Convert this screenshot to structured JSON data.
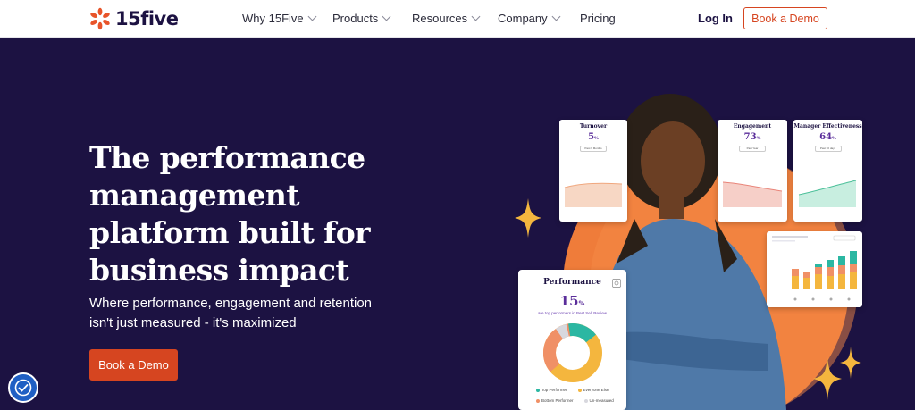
{
  "brand": {
    "name": "15five",
    "accent": "#d64520",
    "navy": "#1c1242"
  },
  "nav": {
    "items": [
      {
        "label": "Why 15Five",
        "dropdown": true
      },
      {
        "label": "Products",
        "dropdown": true
      },
      {
        "label": "Resources",
        "dropdown": true
      },
      {
        "label": "Company",
        "dropdown": true
      },
      {
        "label": "Pricing",
        "dropdown": false
      }
    ],
    "login": "Log In",
    "demo": "Book a Demo"
  },
  "hero": {
    "headline_lines": [
      "The performance",
      "management",
      "platform built for",
      "business impact"
    ],
    "subhead_lines": [
      "Where performance, engagement and retention",
      "isn't just measured - it's maximized"
    ],
    "cta": "Book a Demo"
  },
  "cards": {
    "turnover": {
      "title": "Turnover",
      "value": "5",
      "unit": "%",
      "button": "Past 6 Months"
    },
    "engagement": {
      "title": "Engagement",
      "value": "73",
      "unit": "%",
      "button": "Past Year"
    },
    "manager": {
      "title": "Manager Effectiveness",
      "value": "64",
      "unit": "%",
      "button": "Past 30 days"
    },
    "performance": {
      "title": "Performance",
      "value": "15",
      "unit": "%",
      "subtitle": "are top performers in Best Self Review",
      "legend": [
        "Top Performer",
        "Everyone Else",
        "Bottom Performer",
        "Un-measured"
      ]
    }
  },
  "icons": [
    "logo-burst-icon",
    "chevron-down-icon",
    "accessibility-icon",
    "sparkle-icon"
  ]
}
